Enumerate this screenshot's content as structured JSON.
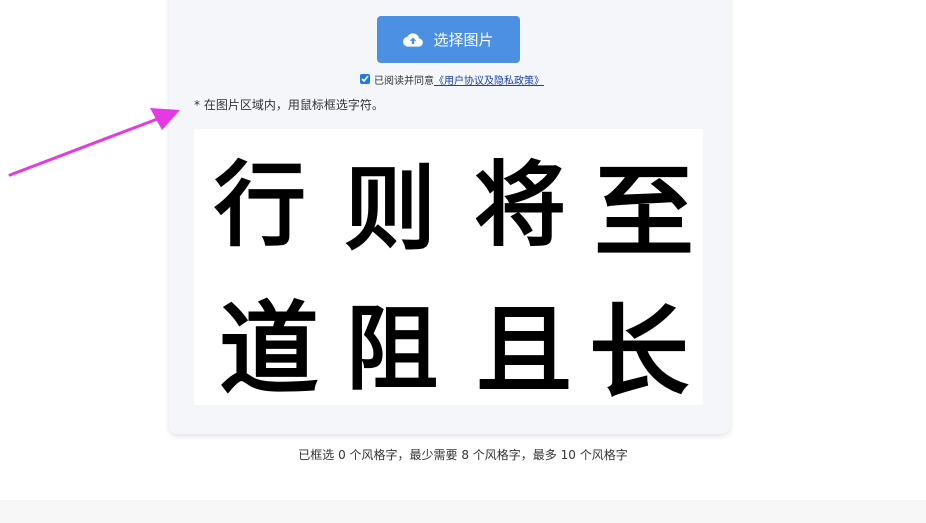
{
  "upload": {
    "button_label": "选择图片",
    "button_icon": "cloud-upload-icon",
    "accent_color": "#4b90e2"
  },
  "agreement": {
    "checked": true,
    "text": "已阅读并同意",
    "link_text": "《用户协议及隐私政策》"
  },
  "hint": "* 在图片区域内，用鼠标框选字符。",
  "image": {
    "glyphs_row1": [
      "行",
      "则",
      "将",
      "至"
    ],
    "glyphs_row2": [
      "道",
      "阻",
      "且",
      "长"
    ]
  },
  "status": "已框选 0 个风格字，最少需要 8 个风格字，最多 10 个风格字",
  "annotation": {
    "arrow_color": "#e53ae3"
  }
}
